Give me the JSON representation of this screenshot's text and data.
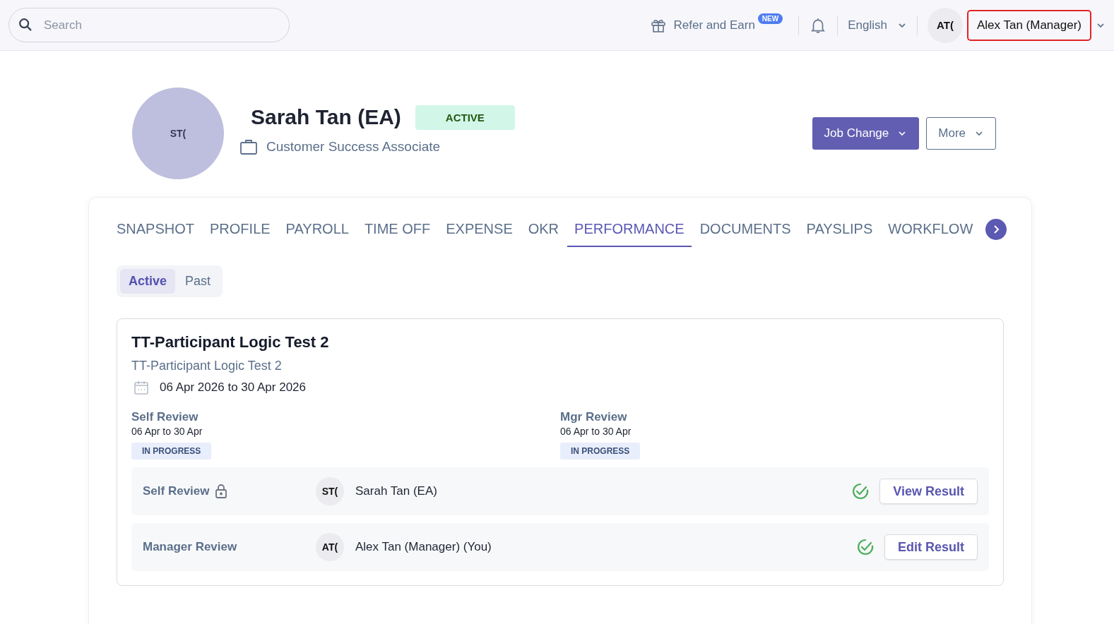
{
  "topbar": {
    "search": {
      "placeholder": "Search"
    },
    "refer": {
      "label": "Refer and Earn",
      "badge": "NEW"
    },
    "language": "English",
    "user": {
      "initials": "AT(",
      "name": "Alex Tan (Manager)",
      "highlighted": true
    }
  },
  "profile": {
    "initials": "ST(",
    "name": "Sarah Tan (EA)",
    "status": "ACTIVE",
    "position": "Customer Success Associate",
    "buttons": [
      {
        "label": "Job Change",
        "kind": "primary"
      },
      {
        "label": "More",
        "kind": "outline"
      }
    ]
  },
  "tabs": [
    {
      "label": "SNAPSHOT",
      "selected": false
    },
    {
      "label": "PROFILE",
      "selected": false
    },
    {
      "label": "PAYROLL",
      "selected": false
    },
    {
      "label": "TIME OFF",
      "selected": false
    },
    {
      "label": "EXPENSE",
      "selected": false
    },
    {
      "label": "OKR",
      "selected": false
    },
    {
      "label": "PERFORMANCE",
      "selected": true
    },
    {
      "label": "DOCUMENTS",
      "selected": false
    },
    {
      "label": "PAYSLIPS",
      "selected": false
    },
    {
      "label": "WORKFLOW",
      "selected": false
    }
  ],
  "filter": [
    {
      "label": "Active",
      "selected": true
    },
    {
      "label": "Past",
      "selected": false
    }
  ],
  "review": {
    "title": "TT-Participant Logic Test 2",
    "subtitle": "TT-Participant Logic Test 2",
    "dates": "06 Apr 2026 to 30 Apr 2026",
    "stages": [
      {
        "name": "Self Review",
        "dates": "06 Apr to 30 Apr",
        "status": "IN PROGRESS"
      },
      {
        "name": "Mgr Review",
        "dates": "06 Apr to 30 Apr",
        "status": "IN PROGRESS"
      }
    ],
    "rows": [
      {
        "label": "Self Review",
        "locked": true,
        "initials": "ST(",
        "person": "Sarah Tan (EA)",
        "done": true,
        "action": "View Result"
      },
      {
        "label": "Manager Review",
        "locked": false,
        "initials": "AT(",
        "person": "Alex Tan (Manager) (You)",
        "done": true,
        "action": "Edit Result"
      }
    ]
  }
}
